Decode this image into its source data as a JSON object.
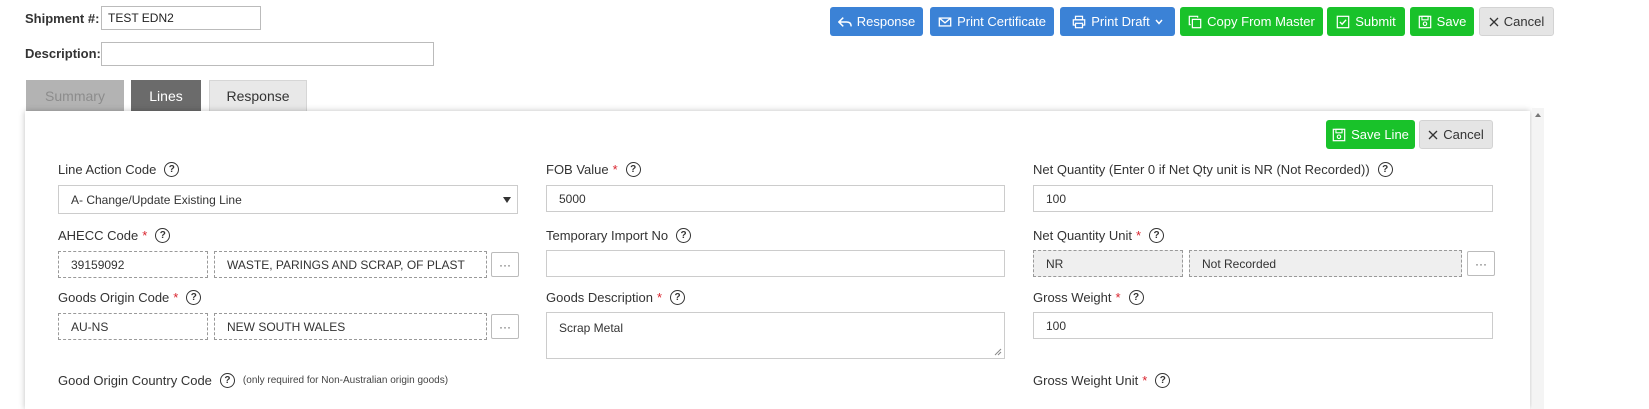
{
  "header": {
    "shipment_label": "Shipment #:",
    "shipment_value": "TEST EDN2",
    "description_label": "Description:",
    "description_value": ""
  },
  "toolbar": {
    "response": "Response",
    "print_certificate": "Print Certificate",
    "print_draft": "Print Draft",
    "copy_from_master": "Copy From Master",
    "submit": "Submit",
    "save": "Save",
    "cancel": "Cancel"
  },
  "tabs": [
    {
      "label": "Summary",
      "state": "disabled"
    },
    {
      "label": "Lines",
      "state": "active"
    },
    {
      "label": "Response",
      "state": "normal"
    }
  ],
  "panel": {
    "save_line": "Save Line",
    "cancel": "Cancel"
  },
  "form": {
    "line_action_code": {
      "label": "Line Action Code",
      "value": "A- Change/Update Existing Line"
    },
    "fob_value": {
      "label": "FOB Value",
      "value": "5000"
    },
    "net_quantity": {
      "label": "Net Quantity (Enter 0 if Net Qty unit is NR (Not Recorded))",
      "value": "100"
    },
    "ahecc_code": {
      "label": "AHECC Code",
      "code": "39159092",
      "description": "WASTE, PARINGS AND SCRAP, OF PLAST"
    },
    "temporary_import_no": {
      "label": "Temporary Import No",
      "value": ""
    },
    "net_quantity_unit": {
      "label": "Net Quantity Unit ",
      "code": "NR",
      "description": "Not Recorded"
    },
    "goods_origin_code": {
      "label": "Goods Origin Code",
      "code": "AU-NS",
      "description": "NEW SOUTH WALES"
    },
    "goods_description": {
      "label": "Goods Description",
      "value": "Scrap Metal"
    },
    "gross_weight": {
      "label": "Gross Weight",
      "value": "100"
    },
    "good_origin_country_code": {
      "label": "Good Origin Country Code",
      "note": "(only required for Non-Australian origin goods)"
    },
    "gross_weight_unit": {
      "label": "Gross Weight Unit"
    },
    "required_mark": "*",
    "lookup_button": "···",
    "help_glyph": "?"
  },
  "colors": {
    "primary_blue": "#3b82d6",
    "success_green": "#19c22a",
    "required_red": "#d9232d",
    "tab_active": "#6b6b6b",
    "tab_disabled": "#b3b3b3"
  }
}
